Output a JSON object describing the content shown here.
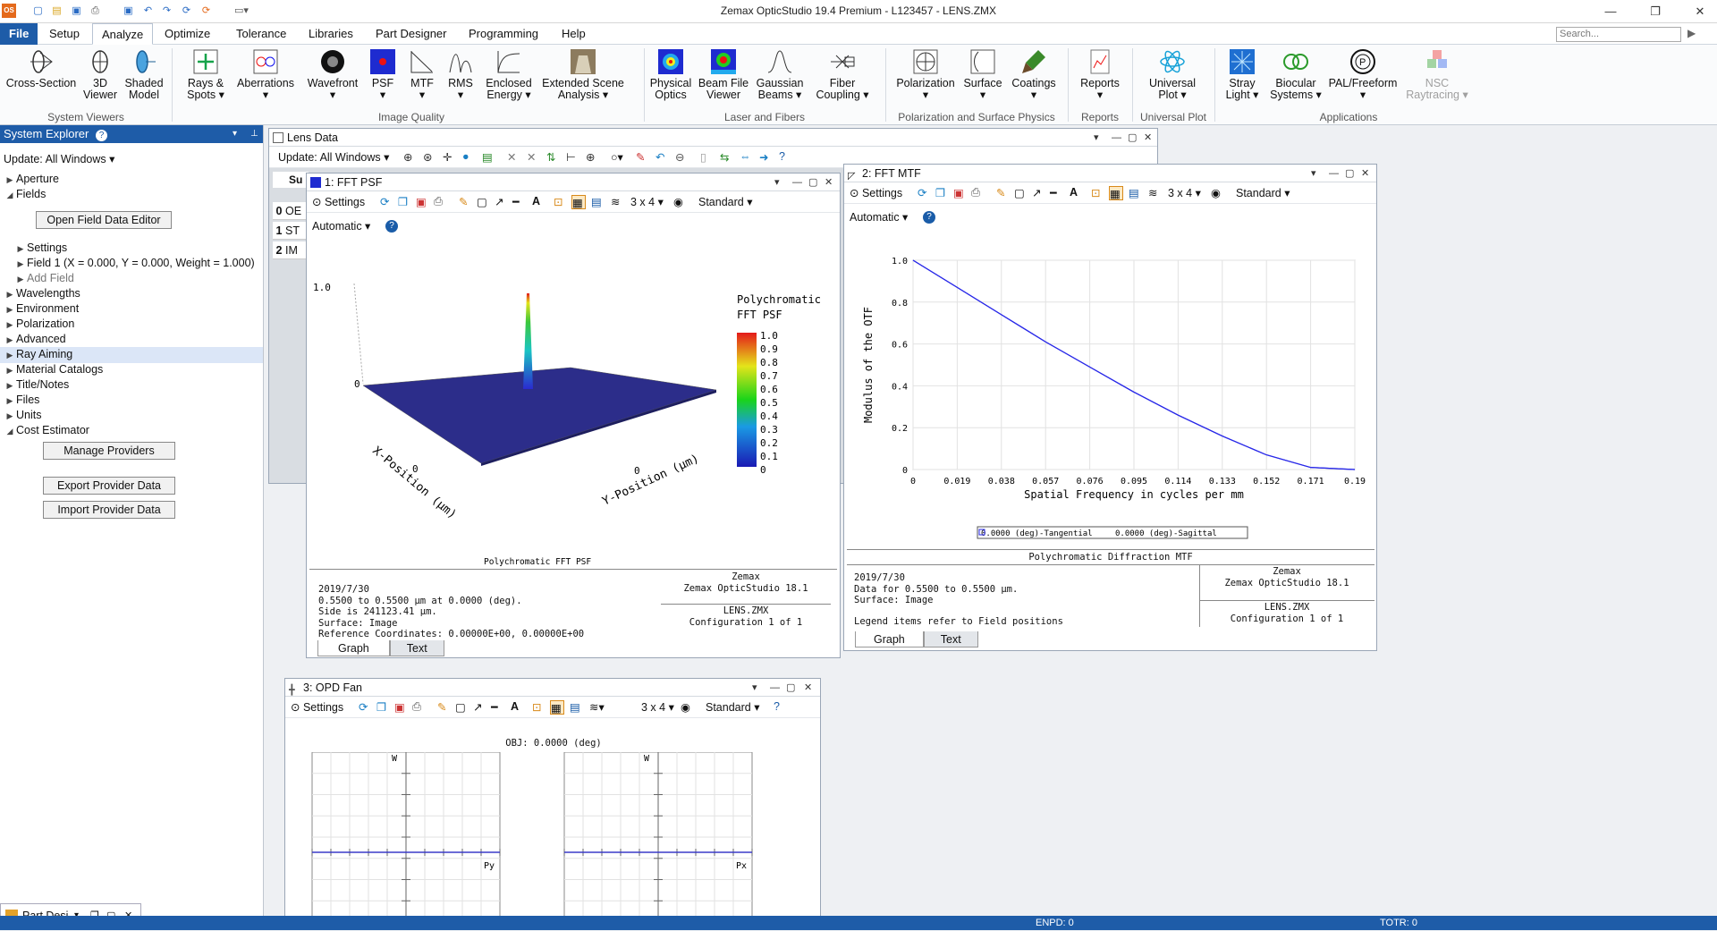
{
  "app": {
    "title": "Zemax OpticStudio 19.4    Premium - L123457 - LENS.ZMX",
    "logo": "OS"
  },
  "menu": [
    "File",
    "Setup",
    "Analyze",
    "Optimize",
    "Tolerance",
    "Libraries",
    "Part Designer",
    "Programming",
    "Help"
  ],
  "search_placeholder": "Search...",
  "ribbon": {
    "buttons": [
      {
        "l1": "Cross-Section",
        "l2": ""
      },
      {
        "l1": "3D",
        "l2": "Viewer"
      },
      {
        "l1": "Shaded",
        "l2": "Model"
      },
      {
        "l1": "Rays &",
        "l2": "Spots ▾"
      },
      {
        "l1": "Aberrations",
        "l2": "▾"
      },
      {
        "l1": "Wavefront",
        "l2": "▾"
      },
      {
        "l1": "PSF",
        "l2": "▾"
      },
      {
        "l1": "MTF",
        "l2": "▾"
      },
      {
        "l1": "RMS",
        "l2": "▾"
      },
      {
        "l1": "Enclosed",
        "l2": "Energy ▾"
      },
      {
        "l1": "Extended Scene",
        "l2": "Analysis ▾"
      },
      {
        "l1": "Physical",
        "l2": "Optics"
      },
      {
        "l1": "Beam File",
        "l2": "Viewer"
      },
      {
        "l1": "Gaussian",
        "l2": "Beams ▾"
      },
      {
        "l1": "Fiber",
        "l2": "Coupling ▾"
      },
      {
        "l1": "Polarization",
        "l2": "▾"
      },
      {
        "l1": "Surface",
        "l2": "▾"
      },
      {
        "l1": "Coatings",
        "l2": "▾"
      },
      {
        "l1": "Reports",
        "l2": "▾"
      },
      {
        "l1": "Universal",
        "l2": "Plot ▾"
      },
      {
        "l1": "Stray",
        "l2": "Light ▾"
      },
      {
        "l1": "Biocular",
        "l2": "Systems ▾"
      },
      {
        "l1": "PAL/Freeform",
        "l2": "▾"
      },
      {
        "l1": "NSC",
        "l2": "Raytracing ▾"
      }
    ],
    "groups": [
      "System Viewers",
      "Image Quality",
      "Laser and Fibers",
      "Polarization and Surface Physics",
      "Reports",
      "Universal Plot",
      "Applications"
    ]
  },
  "explorer": {
    "title": "System Explorer",
    "update": "Update: All Windows ▾",
    "items": [
      "Aperture",
      "Fields",
      "Settings",
      "Field 1 (X = 0.000, Y = 0.000, Weight = 1.000)",
      "Add Field",
      "Wavelengths",
      "Environment",
      "Polarization",
      "Advanced",
      "Ray Aiming",
      "Material Catalogs",
      "Title/Notes",
      "Files",
      "Units",
      "Cost Estimator"
    ],
    "buttons": [
      "Open Field Data Editor",
      "Manage Providers",
      "Export Provider Data",
      "Import Provider Data"
    ]
  },
  "lensdata": {
    "title": "Lens Data",
    "update": "Update: All Windows ▾",
    "rows": [
      "0",
      "1",
      "2"
    ],
    "cells": [
      "OE",
      "ST",
      "IM"
    ],
    "col": "Su"
  },
  "common": {
    "settings": "Settings",
    "automatic": "Automatic ▾",
    "grid": "3 x 4 ▾",
    "standard": "Standard ▾",
    "graph_tab": "Graph",
    "text_tab": "Text"
  },
  "psf": {
    "title": "1: FFT PSF",
    "plot_title_1": "Polychromatic",
    "plot_title_2": "FFT PSF",
    "scale": [
      "1.0",
      "0.9",
      "0.8",
      "0.7",
      "0.6",
      "0.5",
      "0.4",
      "0.3",
      "0.2",
      "0.1",
      "0"
    ],
    "z_top": "1.0",
    "z_zero": "0",
    "x_zero": "0",
    "y_zero": "0",
    "xlabel": "X-Position (µm)",
    "ylabel": "Y-Position (µm)",
    "caption": "Polychromatic FFT PSF",
    "footer_left": [
      "2019/7/30",
      "0.5500 to 0.5500 µm at 0.0000 (deg).",
      "Side is 241123.41 µm.",
      "Surface: Image",
      "Reference Coordinates: 0.00000E+00, 0.00000E+00"
    ],
    "footer_r1": [
      "Zemax",
      "Zemax OpticStudio 18.1"
    ],
    "footer_r2": [
      "LENS.ZMX",
      "Configuration 1 of 1"
    ]
  },
  "mtf": {
    "title": "2: FFT MTF",
    "chart_data": {
      "type": "line",
      "xlabel": "Spatial Frequency in cycles per mm",
      "ylabel": "Modulus of the OTF",
      "xticks": [
        "0",
        "0.019",
        "0.038",
        "0.057",
        "0.076",
        "0.095",
        "0.114",
        "0.133",
        "0.152",
        "0.171",
        "0.19"
      ],
      "yticks": [
        "0",
        "0.2",
        "0.4",
        "0.6",
        "0.8",
        "1.0"
      ],
      "xlim": [
        0,
        0.19
      ],
      "ylim": [
        0,
        1.0
      ],
      "series": [
        {
          "name": "0.0000 (deg)-Tangential",
          "x": [
            0,
            0.019,
            0.038,
            0.057,
            0.076,
            0.095,
            0.114,
            0.133,
            0.152,
            0.171,
            0.19
          ],
          "y": [
            1.0,
            0.87,
            0.74,
            0.61,
            0.49,
            0.37,
            0.26,
            0.16,
            0.07,
            0.01,
            0.0
          ]
        },
        {
          "name": "0.0000 (deg)-Sagittal",
          "x": [
            0,
            0.019,
            0.038,
            0.057,
            0.076,
            0.095,
            0.114,
            0.133,
            0.152,
            0.171,
            0.19
          ],
          "y": [
            1.0,
            0.87,
            0.74,
            0.61,
            0.49,
            0.37,
            0.26,
            0.16,
            0.07,
            0.01,
            0.0
          ]
        }
      ],
      "color": "#2a2ae8",
      "grid": true
    },
    "caption": "Polychromatic Diffraction MTF",
    "footer_left": [
      "2019/7/30",
      "Data for 0.5500 to 0.5500 µm.",
      "Surface: Image"
    ],
    "legend_note": "Legend items refer to Field positions",
    "footer_r1": [
      "Zemax",
      "Zemax OpticStudio 18.1"
    ],
    "footer_r2": [
      "LENS.ZMX",
      "Configuration 1 of 1"
    ]
  },
  "opd": {
    "title": "3: OPD Fan",
    "obj": "OBJ: 0.0000 (deg)",
    "w_label": "W",
    "py": "Py",
    "px": "Px"
  },
  "partdesigner": {
    "title": "Part Desi"
  },
  "status": {
    "left": "ENPD: 0",
    "right": "TOTR: 0"
  }
}
